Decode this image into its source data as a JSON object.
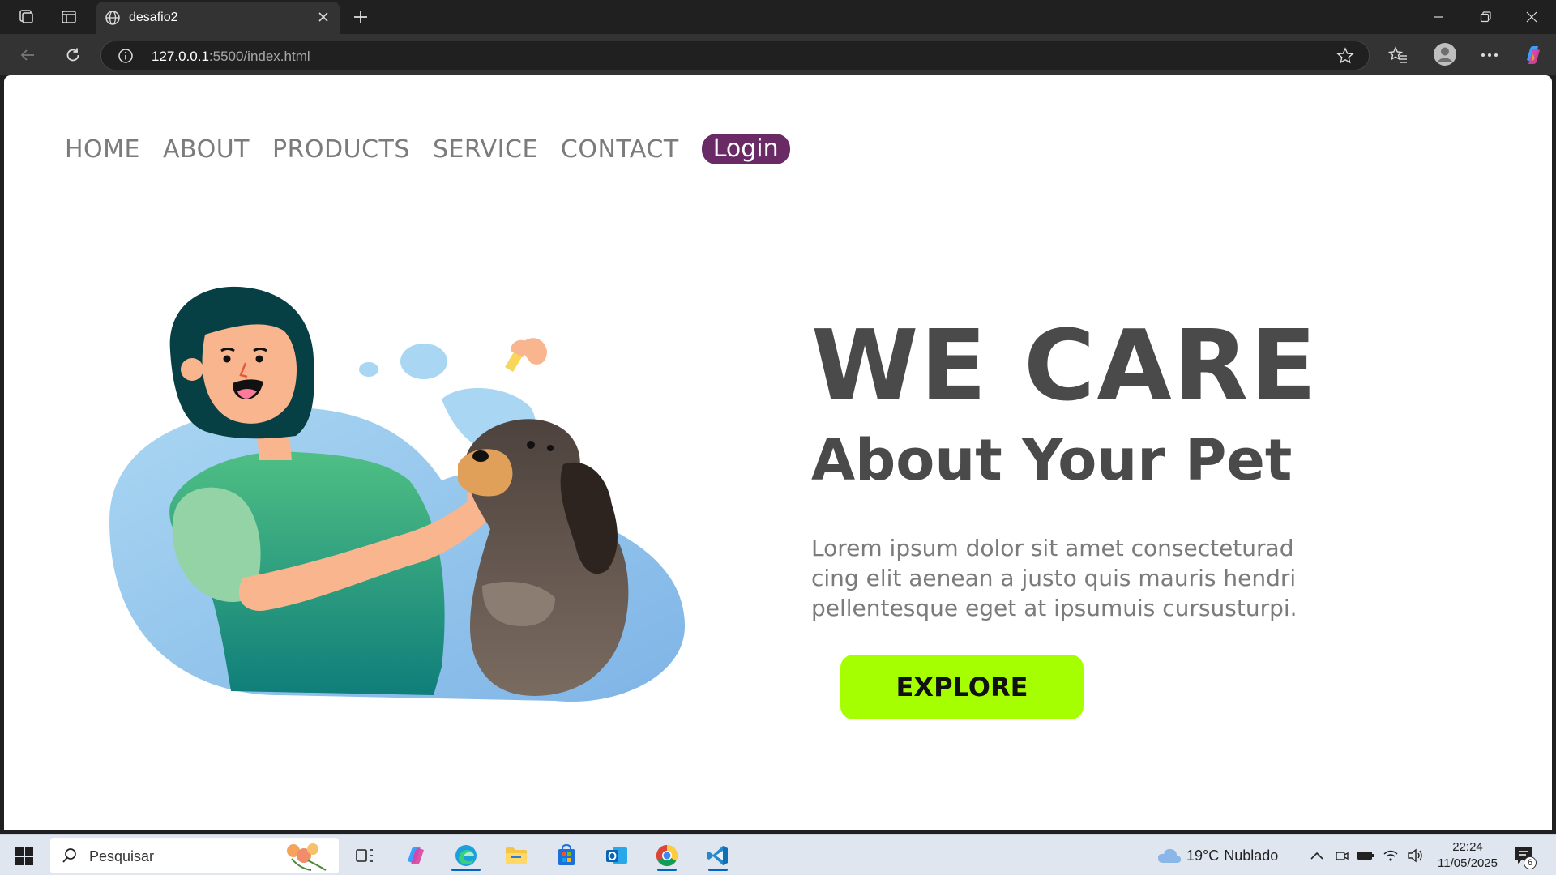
{
  "browser": {
    "tab_title": "desafio2",
    "url_host": "127.0.0.1",
    "url_rest": ":5500/index.html"
  },
  "page": {
    "nav": [
      "HOME",
      "ABOUT",
      "PRODUCTS",
      "SERVICE",
      "CONTACT"
    ],
    "login_label": "Login",
    "hero_title": "WE CARE",
    "hero_subtitle": "About Your Pet",
    "hero_text_lines": [
      "Lorem ipsum dolor sit amet consecteturad",
      "cing elit aenean a justo quis mauris hendri",
      "pellentesque eget at ipsumuis cursusturpi."
    ],
    "explore_label": "EXPLORE"
  },
  "taskbar": {
    "search_placeholder": "Pesquisar",
    "weather_temp": "19°C",
    "weather_text": "Nublado",
    "time": "22:24",
    "date": "11/05/2025",
    "notification_count": "6"
  },
  "colors": {
    "login_bg": "#6a2a66",
    "explore_bg": "#a6ff00",
    "text_dark": "#4a4a4a",
    "text_muted": "#7b7b7b",
    "blob_blue": "#9ccbed"
  }
}
